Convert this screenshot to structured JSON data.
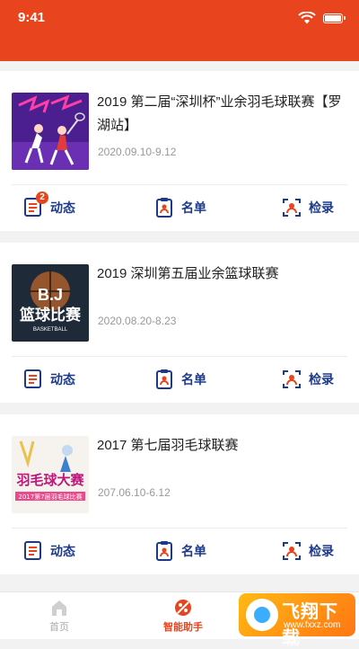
{
  "status_bar": {
    "time": "9:41"
  },
  "colors": {
    "accent": "#e8451e",
    "nav_blue": "#1d3a8a"
  },
  "events": [
    {
      "title": "2019 第二届“深圳杯”业余羽毛球联赛【罗湖站】",
      "date": "2020.09.10-9.12",
      "thumb_icon": "badminton-poster-icon",
      "actions": {
        "feed": "动态",
        "roster": "名单",
        "checkin": "检录"
      },
      "feed_badge": "2"
    },
    {
      "title": "2019 深圳第五届业余篮球联赛",
      "date": "2020.08.20-8.23",
      "thumb_icon": "basketball-poster-icon",
      "thumb_text": {
        "line1": "B.J",
        "line2": "篮球比赛",
        "line3": "BASKETBALL"
      },
      "actions": {
        "feed": "动态",
        "roster": "名单",
        "checkin": "检录"
      }
    },
    {
      "title": "2017 第七届羽毛球联赛",
      "date": "207.06.10-6.12",
      "thumb_icon": "badminton-poster-icon",
      "thumb_text": {
        "line1": "羽毛球大赛",
        "line2": "2017第7届羽毛球比赛"
      },
      "actions": {
        "feed": "动态",
        "roster": "名单",
        "checkin": "检录"
      }
    }
  ],
  "tabbar": {
    "home": "首页",
    "assistant": "智能助手"
  },
  "watermark": {
    "brand": "飞翔下载",
    "url": "www.fxxz.com"
  }
}
